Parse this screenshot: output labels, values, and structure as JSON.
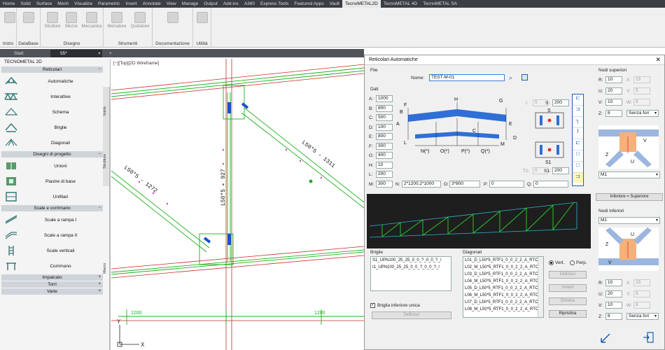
{
  "ribbon_tabs": [
    "Home",
    "Solid",
    "Surface",
    "Mesh",
    "Visualize",
    "Parametric",
    "Insert",
    "Annotate",
    "View",
    "Manage",
    "Output",
    "Add-ins",
    "A360",
    "Express Tools",
    "Featured Apps",
    "Vault",
    "TecnoMETAL2D",
    "TecnoMETAL 4D",
    "TecnoMETAL SA"
  ],
  "ribbon": {
    "inizio": "Inizio",
    "database": "DataBase",
    "disegno_btns": [
      "Strutture",
      "Mezze",
      "Meccanica"
    ],
    "disegno": "Disegno",
    "strumenti_btns": [
      "Mercature",
      "Quotature"
    ],
    "strumenti": "Strumenti",
    "documentazione": "Documentazione",
    "utilita": "Utilità"
  },
  "doc_tabs": {
    "start": "Start",
    "drawing": "55*",
    "add": "+"
  },
  "palette": {
    "title": "TECNOMETAL 2D",
    "sections": {
      "reticolari": "Reticolari",
      "disegni": "Disegni di progetto",
      "scale": "Scale e corrimano",
      "impalcato": "Impalcato",
      "torri": "Torri",
      "varie": "Varie"
    },
    "items": {
      "automatiche": "Automatiche",
      "interattive": "Interattive",
      "schema": "Schema",
      "briglie": "Briglie",
      "diagonali": "Diagonali",
      "unioni": "Unioni",
      "piastre": "Piastre di base",
      "unifilari": "Unifilari",
      "rampa1": "Scale a rampa I",
      "rampa2": "Scale a rampa II",
      "verticali": "Scale verticali",
      "corrimano": "Corrimano"
    },
    "side_tabs": [
      "Inizio",
      "Strutture",
      "Macro"
    ]
  },
  "viewport": {
    "label": "[−][Top][2D Wireframe]",
    "dims": [
      "1200",
      "1200"
    ],
    "members": [
      "L50*5 - 1272",
      "L50*5 - 927",
      "L50*5 - 1311"
    ]
  },
  "dialog": {
    "title": "Reticolari Automatiche",
    "close": "✕",
    "file": "File",
    "nome_label": "Nome:",
    "nome_value": "TEST-M-01",
    "dati": "Dati",
    "fields": [
      {
        "label": "A:",
        "value": "1000"
      },
      {
        "label": "B:",
        "value": "800"
      },
      {
        "label": "C:",
        "value": "500"
      },
      {
        "label": "D:",
        "value": "100"
      },
      {
        "label": "E:",
        "value": "800"
      },
      {
        "label": "F:",
        "value": "300"
      },
      {
        "label": "G:",
        "value": "400"
      },
      {
        "label": "H:",
        "value": "10"
      },
      {
        "label": "L:",
        "value": "200"
      }
    ],
    "m_label": "M:",
    "m_value": "300",
    "n_label": "N:",
    "n_value": "2*1200,2*1000",
    "o_label": "O:",
    "o_value": "3*800",
    "p_label": "P:",
    "p_value": "0",
    "q_label": "Q:",
    "q_value": "0",
    "i_label": "I:",
    "i_value": "0",
    "s_label": "S:",
    "s_value": "200",
    "t1_label": "T1:",
    "t1_value": "0",
    "s1_label": "S1:",
    "s1_value": "200",
    "diagram_letters": [
      "A",
      "B",
      "C",
      "D",
      "E",
      "F",
      "G",
      "H",
      "L",
      "M",
      "N(*)",
      "O(*)",
      "P(*)",
      "Q(*)",
      "S",
      "S1"
    ],
    "briglie_label": "Briglie",
    "briglie": [
      "S1_UPN100_25_25_0_0_?_0_0_?_/",
      "I1_UPN100_25_25_0_0_?_0_0_?_/"
    ],
    "briglia_check": "Briglia inferiore unica",
    "diagonali_label": "Diagonali",
    "diagonali": [
      "L01_D_L50*5_RTF1_0_0_2_2_A_RTC",
      "L02_M_L50*5_RTF1_0_0_2_2_A_RTC",
      "L03_D_L50*5_RTF1_0_0_2_2_A_RTC",
      "L04_M_L50*5_RTF1_0_0_2_2_A_RTC",
      "L05_D_L50*5_RTF1_0_0_2_2_A_RTC",
      "L06_M_L50*5_RTF1_0_0_2_2_A_RTC",
      "L07_D_L50*5_RTF1_0_0_2_2_A_RTC",
      "L08_M_L50*5_RTF1_0_0_2_2_A_RTC"
    ],
    "vert": "Vert.",
    "perp": "Perp.",
    "definisci": "Definisci",
    "inverti": "Inverti",
    "elimina": "Elimina",
    "ripristina": "Ripristina",
    "nodi_sup": "Nodi superiori",
    "nodi_inf": "Nodi inferiori",
    "sup": {
      "r": "10",
      "u": "20",
      "v": "10",
      "z": "8",
      "x": "15",
      "y": "5",
      "w": "8",
      "fori": "Senza fori",
      "sel": "M1"
    },
    "inf": {
      "r": "10",
      "u": "20",
      "v": "10",
      "z": "8",
      "x": "15",
      "y": "5",
      "w": "8",
      "fori": "Senza fori",
      "sel": "M1"
    },
    "inf_eq_sup": "Inferiore = Superiore"
  }
}
